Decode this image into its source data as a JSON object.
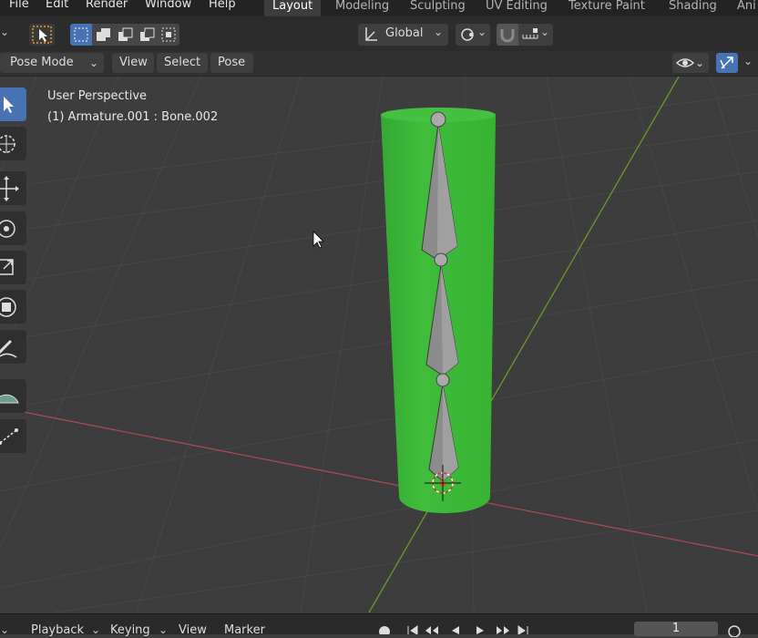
{
  "menu": {
    "file": "File",
    "edit": "Edit",
    "render": "Render",
    "window": "Window",
    "help": "Help"
  },
  "workspaces": [
    "Layout",
    "Modeling",
    "Sculpting",
    "UV Editing",
    "Texture Paint",
    "Shading",
    "Ani"
  ],
  "active_workspace": "Layout",
  "tool_header": {
    "orientation": "Global"
  },
  "view_header": {
    "mode": "Pose Mode",
    "view": "View",
    "select": "Select",
    "pose": "Pose"
  },
  "viewport": {
    "perspective": "User Perspective",
    "active_object": "(1) Armature.001 : Bone.002"
  },
  "timeline": {
    "playback": "Playback",
    "keying": "Keying",
    "view": "View",
    "marker": "Marker",
    "frame": "1"
  },
  "colors": {
    "accent": "#4772b3",
    "mesh": "#3db53a",
    "x_axis": "#a84a54",
    "y_axis": "#6a9a26"
  }
}
